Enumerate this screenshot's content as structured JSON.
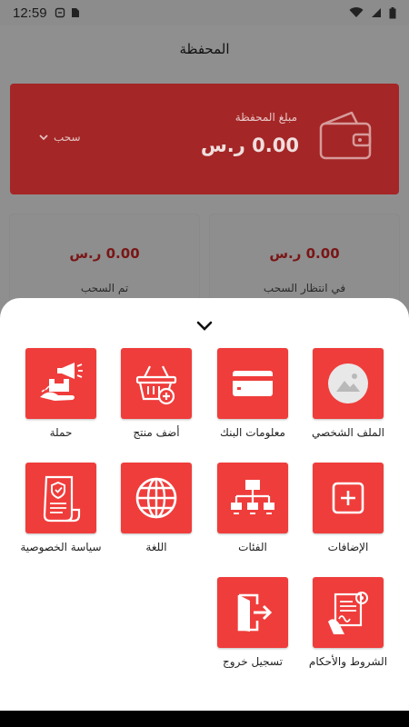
{
  "status_bar": {
    "time": "12:59"
  },
  "header": {
    "title": "المحفظة"
  },
  "wallet": {
    "amount_label": "مبلغ المحفظة",
    "amount_value": "0.00 ر.س",
    "withdraw_label": "سحب"
  },
  "stats": [
    {
      "value": "0.00 ر.س",
      "label": "في انتظار السحب"
    },
    {
      "value": "0.00 ر.س",
      "label": "تم السحب"
    }
  ],
  "menu": {
    "items": [
      {
        "label": "الملف الشخصي",
        "icon": "profile-image-icon"
      },
      {
        "label": "معلومات البنك",
        "icon": "bank-card-icon"
      },
      {
        "label": "أضف منتج",
        "icon": "add-product-basket-icon"
      },
      {
        "label": "حملة",
        "icon": "campaign-megaphone-icon"
      },
      {
        "label": "الإضافات",
        "icon": "add-plus-icon"
      },
      {
        "label": "الفئات",
        "icon": "categories-hierarchy-icon"
      },
      {
        "label": "اللغة",
        "icon": "language-globe-icon"
      },
      {
        "label": "سياسة الخصوصية",
        "icon": "privacy-policy-icon"
      },
      {
        "label": "الشروط والأحكام",
        "icon": "terms-conditions-icon"
      },
      {
        "label": "تسجيل خروج",
        "icon": "logout-icon"
      }
    ]
  },
  "colors": {
    "accent": "#ef3d3b",
    "sheet_background": "#ffffff",
    "overlay": "#8f8f8f"
  }
}
